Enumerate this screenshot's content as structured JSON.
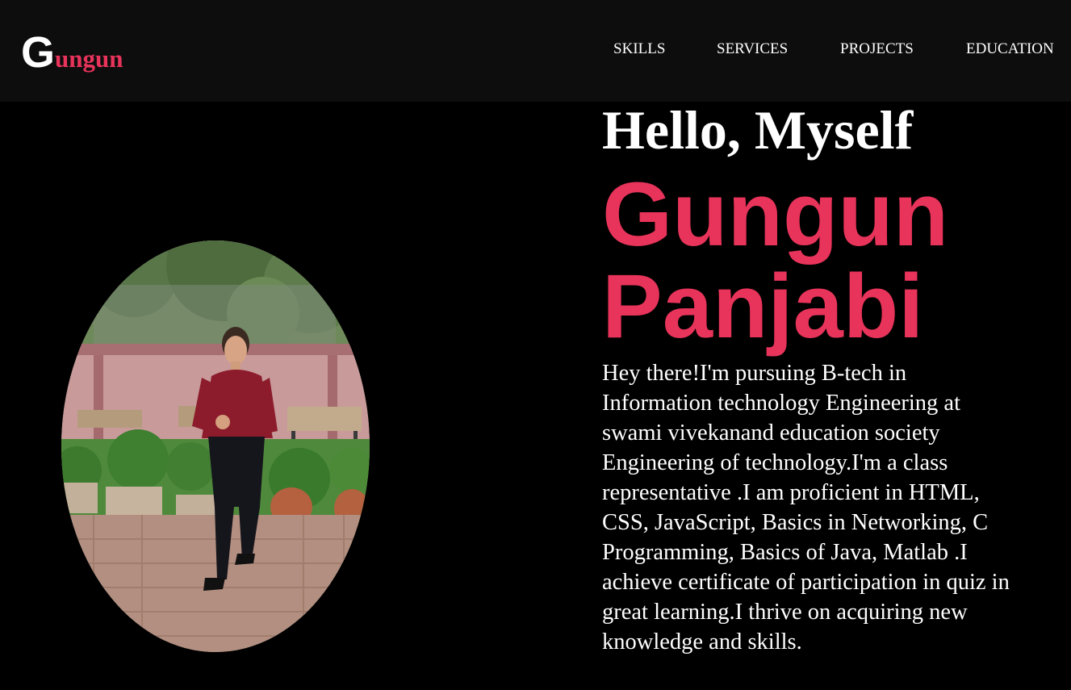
{
  "header": {
    "logo_initial": "G",
    "logo_rest": "ungun",
    "nav": [
      {
        "label": "SKILLS"
      },
      {
        "label": "SERVICES"
      },
      {
        "label": "PROJECTS"
      },
      {
        "label": "EDUCATION"
      }
    ]
  },
  "hero": {
    "greeting": "Hello, Myself",
    "first_name": "Gungun",
    "last_name": "Panjabi",
    "bio": "Hey there!I'm pursuing B-tech in Information technology Engineering at swami vivekanand education society Engineering of technology.I'm a class representative .I am proficient in HTML, CSS, JavaScript, Basics in Networking, C Programming, Basics of Java, Matlab .I achieve certificate of participation in quiz in great learning.I thrive on acquiring new knowledge and skills."
  },
  "colors": {
    "accent": "#e8335a",
    "nav_background": "#0d0d0d",
    "page_background": "#000000",
    "text": "#ffffff"
  }
}
